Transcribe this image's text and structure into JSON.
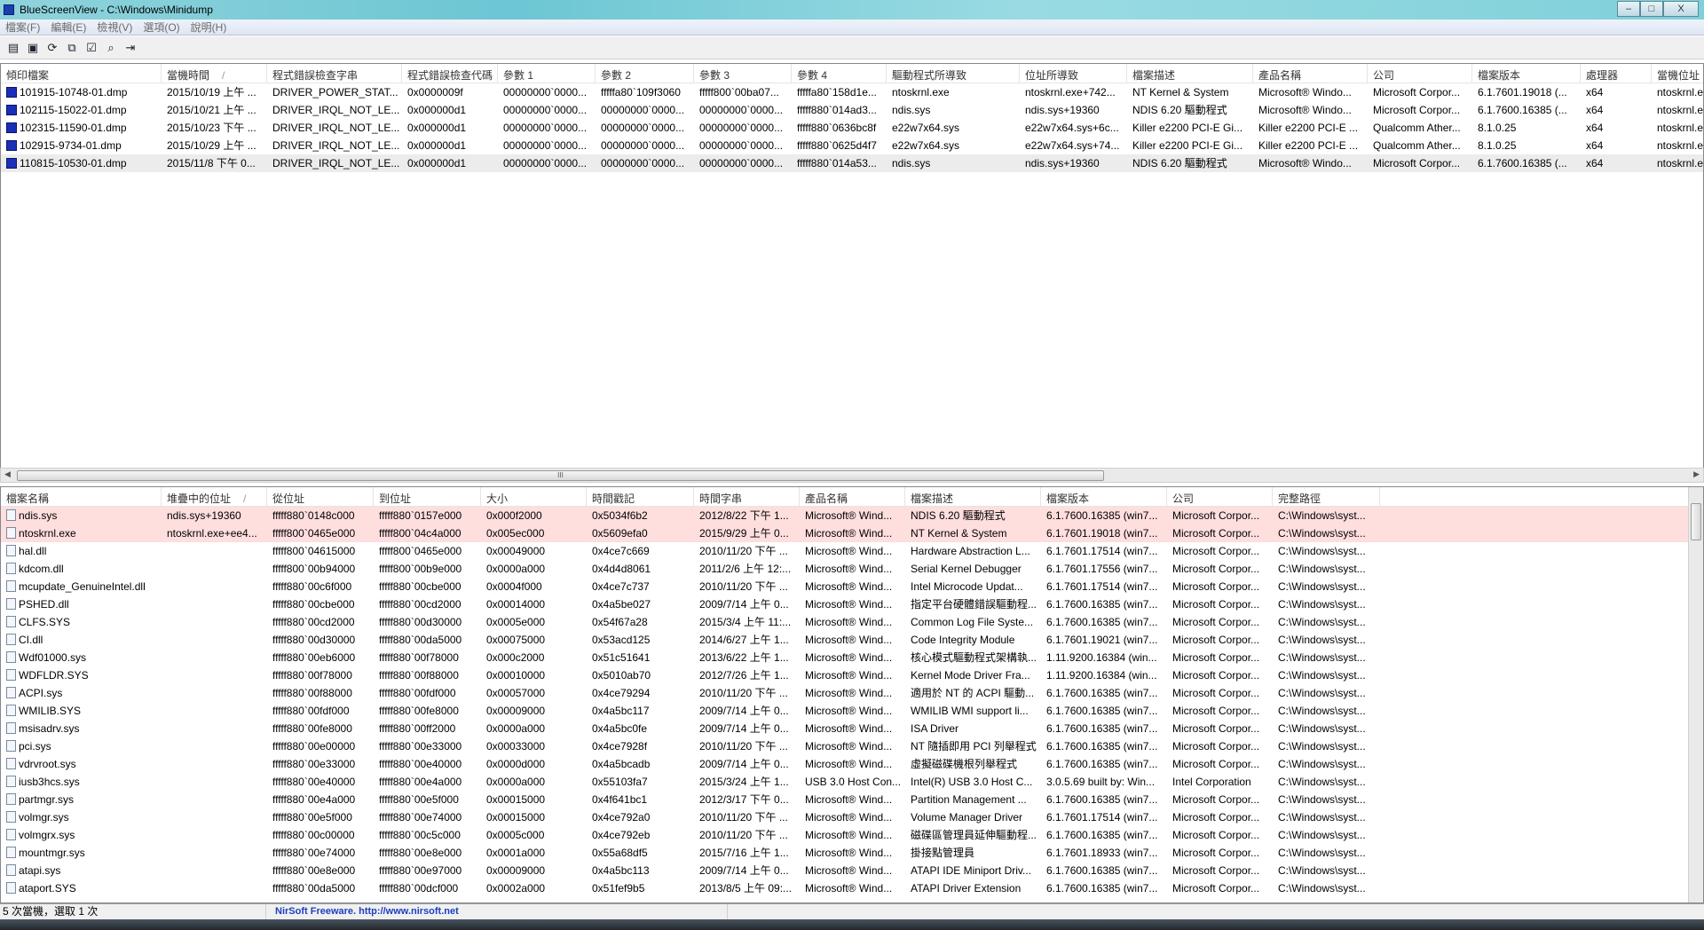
{
  "window": {
    "title": "BlueScreenView  -  C:\\Windows\\Minidump",
    "min": "–",
    "max": "□",
    "close": "X"
  },
  "menu": [
    "檔案(F)",
    "編輯(E)",
    "檢視(V)",
    "選項(O)",
    "說明(H)"
  ],
  "toolbar": [
    {
      "icon": "properties-icon",
      "glyph": "▤"
    },
    {
      "icon": "save-icon",
      "glyph": "▣"
    },
    {
      "icon": "refresh-icon",
      "glyph": "⟳"
    },
    {
      "icon": "copy-icon",
      "glyph": "⧉"
    },
    {
      "icon": "advanced-options-icon",
      "glyph": "☑"
    },
    {
      "icon": "find-icon",
      "glyph": "⌕"
    },
    {
      "icon": "exit-icon",
      "glyph": "⇥"
    }
  ],
  "dumps": {
    "columns": [
      "傾印檔案",
      "當機時間",
      "程式錯誤檢查字串",
      "程式錯誤檢查代碼",
      "參數 1",
      "參數 2",
      "參數 3",
      "參數 4",
      "驅動程式所導致",
      "位址所導致",
      "檔案描述",
      "產品名稱",
      "公司",
      "檔案版本",
      "處理器",
      "當機位址"
    ],
    "sort_indicator": "/",
    "rows": [
      [
        "101915-10748-01.dmp",
        "2015/10/19 上午 ...",
        "DRIVER_POWER_STAT...",
        "0x0000009f",
        "00000000`0000...",
        "fffffa80`109f3060",
        "fffff800`00ba07...",
        "fffffa80`158d1e...",
        "ntoskrnl.exe",
        "ntoskrnl.exe+742...",
        "NT Kernel & System",
        "Microsoft® Windo...",
        "Microsoft Corpor...",
        "6.1.7601.19018 (...",
        "x64",
        "ntoskrnl.e"
      ],
      [
        "102115-15022-01.dmp",
        "2015/10/21 上午 ...",
        "DRIVER_IRQL_NOT_LE...",
        "0x000000d1",
        "00000000`0000...",
        "00000000`0000...",
        "00000000`0000...",
        "fffff880`014ad3...",
        "ndis.sys",
        "ndis.sys+19360",
        "NDIS 6.20 驅動程式",
        "Microsoft® Windo...",
        "Microsoft Corpor...",
        "6.1.7600.16385 (...",
        "x64",
        "ntoskrnl.e"
      ],
      [
        "102315-11590-01.dmp",
        "2015/10/23 下午 ...",
        "DRIVER_IRQL_NOT_LE...",
        "0x000000d1",
        "00000000`0000...",
        "00000000`0000...",
        "00000000`0000...",
        "fffff880`0636bc8f",
        "e22w7x64.sys",
        "e22w7x64.sys+6c...",
        "Killer e2200 PCI-E Gi...",
        "Killer e2200 PCI-E ...",
        "Qualcomm Ather...",
        "8.1.0.25",
        "x64",
        "ntoskrnl.e"
      ],
      [
        "102915-9734-01.dmp",
        "2015/10/29 上午 ...",
        "DRIVER_IRQL_NOT_LE...",
        "0x000000d1",
        "00000000`0000...",
        "00000000`0000...",
        "00000000`0000...",
        "fffff880`0625d4f7",
        "e22w7x64.sys",
        "e22w7x64.sys+74...",
        "Killer e2200 PCI-E Gi...",
        "Killer e2200 PCI-E ...",
        "Qualcomm Ather...",
        "8.1.0.25",
        "x64",
        "ntoskrnl.e"
      ],
      [
        "110815-10530-01.dmp",
        "2015/11/8 下午 0...",
        "DRIVER_IRQL_NOT_LE...",
        "0x000000d1",
        "00000000`0000...",
        "00000000`0000...",
        "00000000`0000...",
        "fffff880`014a53...",
        "ndis.sys",
        "ndis.sys+19360",
        "NDIS 6.20 驅動程式",
        "Microsoft® Windo...",
        "Microsoft Corpor...",
        "6.1.7600.16385 (...",
        "x64",
        "ntoskrnl.e"
      ]
    ],
    "selected_row": 4
  },
  "modules": {
    "columns": [
      "檔案名稱",
      "堆疊中的位址",
      "從位址",
      "到位址",
      "大小",
      "時間戳記",
      "時間字串",
      "產品名稱",
      "檔案描述",
      "檔案版本",
      "公司",
      "完整路徑"
    ],
    "sort_indicator": "/",
    "highlight_rows": [
      0,
      1
    ],
    "rows": [
      [
        "ndis.sys",
        "ndis.sys+19360",
        "fffff880`0148c000",
        "fffff880`0157e000",
        "0x000f2000",
        "0x5034f6b2",
        "2012/8/22 下午 1...",
        "Microsoft® Wind...",
        "NDIS 6.20 驅動程式",
        "6.1.7600.16385 (win7...",
        "Microsoft Corpor...",
        "C:\\Windows\\syst..."
      ],
      [
        "ntoskrnl.exe",
        "ntoskrnl.exe+ee4...",
        "fffff800`0465e000",
        "fffff800`04c4a000",
        "0x005ec000",
        "0x5609efa0",
        "2015/9/29 上午 0...",
        "Microsoft® Wind...",
        "NT Kernel & System",
        "6.1.7601.19018 (win7...",
        "Microsoft Corpor...",
        "C:\\Windows\\syst..."
      ],
      [
        "hal.dll",
        "",
        "fffff800`04615000",
        "fffff800`0465e000",
        "0x00049000",
        "0x4ce7c669",
        "2010/11/20 下午 ...",
        "Microsoft® Wind...",
        "Hardware Abstraction L...",
        "6.1.7601.17514 (win7...",
        "Microsoft Corpor...",
        "C:\\Windows\\syst..."
      ],
      [
        "kdcom.dll",
        "",
        "fffff800`00b94000",
        "fffff800`00b9e000",
        "0x0000a000",
        "0x4d4d8061",
        "2011/2/6 上午 12:...",
        "Microsoft® Wind...",
        "Serial Kernel Debugger",
        "6.1.7601.17556 (win7...",
        "Microsoft Corpor...",
        "C:\\Windows\\syst..."
      ],
      [
        "mcupdate_GenuineIntel.dll",
        "",
        "fffff880`00c6f000",
        "fffff880`00cbe000",
        "0x0004f000",
        "0x4ce7c737",
        "2010/11/20 下午 ...",
        "Microsoft® Wind...",
        "Intel Microcode Updat...",
        "6.1.7601.17514 (win7...",
        "Microsoft Corpor...",
        "C:\\Windows\\syst..."
      ],
      [
        "PSHED.dll",
        "",
        "fffff880`00cbe000",
        "fffff880`00cd2000",
        "0x00014000",
        "0x4a5be027",
        "2009/7/14 上午 0...",
        "Microsoft® Wind...",
        "指定平台硬體錯誤驅動程...",
        "6.1.7600.16385 (win7...",
        "Microsoft Corpor...",
        "C:\\Windows\\syst..."
      ],
      [
        "CLFS.SYS",
        "",
        "fffff880`00cd2000",
        "fffff880`00d30000",
        "0x0005e000",
        "0x54f67a28",
        "2015/3/4 上午 11:...",
        "Microsoft® Wind...",
        "Common Log File Syste...",
        "6.1.7600.16385 (win7...",
        "Microsoft Corpor...",
        "C:\\Windows\\syst..."
      ],
      [
        "CI.dll",
        "",
        "fffff880`00d30000",
        "fffff880`00da5000",
        "0x00075000",
        "0x53acd125",
        "2014/6/27 上午 1...",
        "Microsoft® Wind...",
        "Code Integrity Module",
        "6.1.7601.19021 (win7...",
        "Microsoft Corpor...",
        "C:\\Windows\\syst..."
      ],
      [
        "Wdf01000.sys",
        "",
        "fffff880`00eb6000",
        "fffff880`00f78000",
        "0x000c2000",
        "0x51c51641",
        "2013/6/22 上午 1...",
        "Microsoft® Wind...",
        "核心模式驅動程式架構執...",
        "1.11.9200.16384 (win...",
        "Microsoft Corpor...",
        "C:\\Windows\\syst..."
      ],
      [
        "WDFLDR.SYS",
        "",
        "fffff880`00f78000",
        "fffff880`00f88000",
        "0x00010000",
        "0x5010ab70",
        "2012/7/26 上午 1...",
        "Microsoft® Wind...",
        "Kernel Mode Driver Fra...",
        "1.11.9200.16384 (win...",
        "Microsoft Corpor...",
        "C:\\Windows\\syst..."
      ],
      [
        "ACPI.sys",
        "",
        "fffff880`00f88000",
        "fffff880`00fdf000",
        "0x00057000",
        "0x4ce79294",
        "2010/11/20 下午 ...",
        "Microsoft® Wind...",
        "適用於 NT 的 ACPI 驅動...",
        "6.1.7600.16385 (win7...",
        "Microsoft Corpor...",
        "C:\\Windows\\syst..."
      ],
      [
        "WMILIB.SYS",
        "",
        "fffff880`00fdf000",
        "fffff880`00fe8000",
        "0x00009000",
        "0x4a5bc117",
        "2009/7/14 上午 0...",
        "Microsoft® Wind...",
        "WMILIB WMI support li...",
        "6.1.7600.16385 (win7...",
        "Microsoft Corpor...",
        "C:\\Windows\\syst..."
      ],
      [
        "msisadrv.sys",
        "",
        "fffff880`00fe8000",
        "fffff880`00ff2000",
        "0x0000a000",
        "0x4a5bc0fe",
        "2009/7/14 上午 0...",
        "Microsoft® Wind...",
        "ISA Driver",
        "6.1.7600.16385 (win7...",
        "Microsoft Corpor...",
        "C:\\Windows\\syst..."
      ],
      [
        "pci.sys",
        "",
        "fffff880`00e00000",
        "fffff880`00e33000",
        "0x00033000",
        "0x4ce7928f",
        "2010/11/20 下午 ...",
        "Microsoft® Wind...",
        "NT 隨插即用 PCI 列舉程式",
        "6.1.7600.16385 (win7...",
        "Microsoft Corpor...",
        "C:\\Windows\\syst..."
      ],
      [
        "vdrvroot.sys",
        "",
        "fffff880`00e33000",
        "fffff880`00e40000",
        "0x0000d000",
        "0x4a5bcadb",
        "2009/7/14 上午 0...",
        "Microsoft® Wind...",
        "虛擬磁碟機根列舉程式",
        "6.1.7600.16385 (win7...",
        "Microsoft Corpor...",
        "C:\\Windows\\syst..."
      ],
      [
        "iusb3hcs.sys",
        "",
        "fffff880`00e40000",
        "fffff880`00e4a000",
        "0x0000a000",
        "0x55103fa7",
        "2015/3/24 上午 1...",
        "USB 3.0 Host Con...",
        "Intel(R) USB 3.0 Host C...",
        "3.0.5.69 built by: Win...",
        "Intel Corporation",
        "C:\\Windows\\syst..."
      ],
      [
        "partmgr.sys",
        "",
        "fffff880`00e4a000",
        "fffff880`00e5f000",
        "0x00015000",
        "0x4f641bc1",
        "2012/3/17 下午 0...",
        "Microsoft® Wind...",
        "Partition Management ...",
        "6.1.7600.16385 (win7...",
        "Microsoft Corpor...",
        "C:\\Windows\\syst..."
      ],
      [
        "volmgr.sys",
        "",
        "fffff880`00e5f000",
        "fffff880`00e74000",
        "0x00015000",
        "0x4ce792a0",
        "2010/11/20 下午 ...",
        "Microsoft® Wind...",
        "Volume Manager Driver",
        "6.1.7601.17514 (win7...",
        "Microsoft Corpor...",
        "C:\\Windows\\syst..."
      ],
      [
        "volmgrx.sys",
        "",
        "fffff880`00c00000",
        "fffff880`00c5c000",
        "0x0005c000",
        "0x4ce792eb",
        "2010/11/20 下午 ...",
        "Microsoft® Wind...",
        "磁碟區管理員延伸驅動程...",
        "6.1.7600.16385 (win7...",
        "Microsoft Corpor...",
        "C:\\Windows\\syst..."
      ],
      [
        "mountmgr.sys",
        "",
        "fffff880`00e74000",
        "fffff880`00e8e000",
        "0x0001a000",
        "0x55a68df5",
        "2015/7/16 上午 1...",
        "Microsoft® Wind...",
        "掛接點管理員",
        "6.1.7601.18933 (win7...",
        "Microsoft Corpor...",
        "C:\\Windows\\syst..."
      ],
      [
        "atapi.sys",
        "",
        "fffff880`00e8e000",
        "fffff880`00e97000",
        "0x00009000",
        "0x4a5bc113",
        "2009/7/14 上午 0...",
        "Microsoft® Wind...",
        "ATAPI IDE Miniport Driv...",
        "6.1.7600.16385 (win7...",
        "Microsoft Corpor...",
        "C:\\Windows\\syst..."
      ],
      [
        "ataport.SYS",
        "",
        "fffff880`00da5000",
        "fffff880`00dcf000",
        "0x0002a000",
        "0x51fef9b5",
        "2013/8/5 上午 09:...",
        "Microsoft® Wind...",
        "ATAPI Driver Extension",
        "6.1.7600.16385 (win7...",
        "Microsoft Corpor...",
        "C:\\Windows\\syst..."
      ]
    ]
  },
  "scrollbar": {
    "grip": "III"
  },
  "status": {
    "count": "5 次當機，選取 1 次",
    "credit": "NirSoft Freeware.  http://www.nirsoft.net"
  }
}
